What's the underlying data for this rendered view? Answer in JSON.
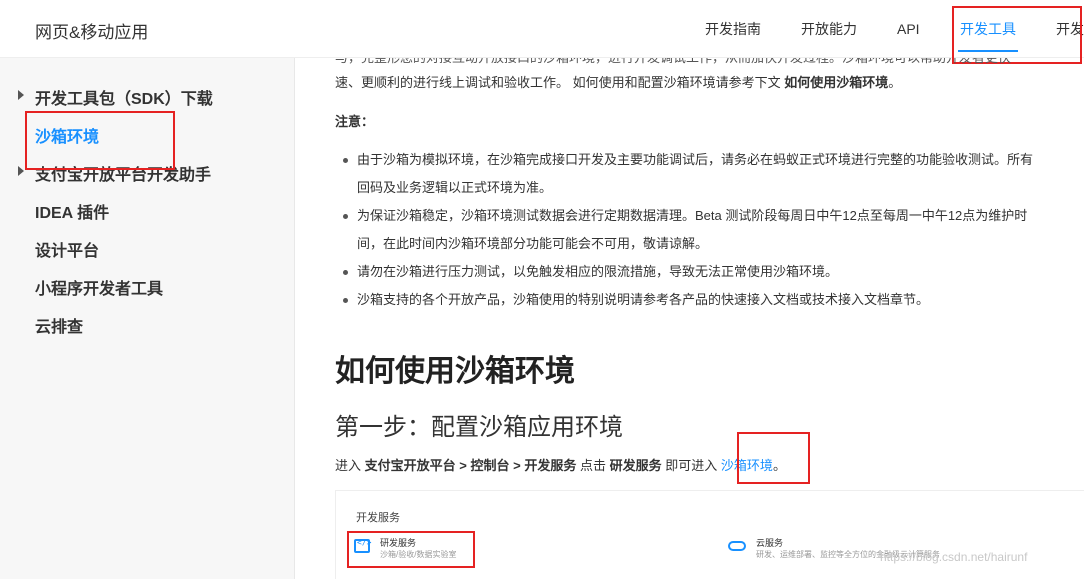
{
  "header": {
    "brand": "网页&移动应用",
    "nav": [
      "开发指南",
      "开放能力",
      "API",
      "开发工具",
      "开发"
    ],
    "active_nav_index": 3
  },
  "sidebar": {
    "items": [
      {
        "label": "开发工具包（SDK）下载",
        "has_caret": true
      },
      {
        "label": "沙箱环境",
        "active": true
      },
      {
        "label": "支付宝开放平台开发助手",
        "has_caret": true
      },
      {
        "label": "IDEA 插件"
      },
      {
        "label": "设计平台"
      },
      {
        "label": "小程序开发者工具"
      },
      {
        "label": "云排查"
      }
    ]
  },
  "content": {
    "top_cut": "与，完整形您的对接互动开放接口的沙箱环境，进行开发调试工作，从而加快开发过程。沙箱环境可以帮助开发者更快",
    "para_line": "速、更顺利的进行线上调试和验收工作。 如何使用和配置沙箱环境请参考下文",
    "para_bold": "如何使用沙箱环境",
    "para_end": "。",
    "note_title": "注意：",
    "bullets": [
      {
        "lines": [
          "由于沙箱为模拟环境，在沙箱完成接口开发及主要功能调试后，请务必在蚂蚁正式环境进行完整的功能验收测试。所有",
          "回码及业务逻辑以正式环境为准。"
        ]
      },
      {
        "lines": [
          "为保证沙箱稳定，沙箱环境测试数据会进行定期数据清理。Beta 测试阶段每周日中午12点至每周一中午12点为维护时",
          "间，在此时间内沙箱环境部分功能可能会不可用，敬请谅解。"
        ]
      },
      {
        "lines": [
          "请勿在沙箱进行压力测试，以免触发相应的限流措施，导致无法正常使用沙箱环境。"
        ]
      },
      {
        "lines": [
          "沙箱支持的各个开放产品，沙箱使用的特别说明请参考各产品的快速接入文档或技术接入文档章节。"
        ]
      }
    ],
    "h1": "如何使用沙箱环境",
    "h2": "第一步：配置沙箱应用环境",
    "step": {
      "p1": "进入",
      "b1": "支付宝开放平台",
      "s1": ">",
      "b2": "控制台",
      "s2": ">",
      "b3": "开发服务",
      "p2": "点击",
      "b4": "研发服务",
      "p3": "即可进入",
      "link": "沙箱环境",
      "end": "。"
    },
    "embed": {
      "title": "开发服务",
      "service1_name": "研发服务",
      "service1_desc": "沙箱/验收/数据实验室",
      "service2_name": "云服务",
      "service2_desc": "研发、运维部署、监控等全方位的金融级云计算服务"
    },
    "watermark": "https://blog.csdn.net/hairunf"
  },
  "colors": {
    "accent": "#1890ff",
    "highlight": "#e52222"
  }
}
